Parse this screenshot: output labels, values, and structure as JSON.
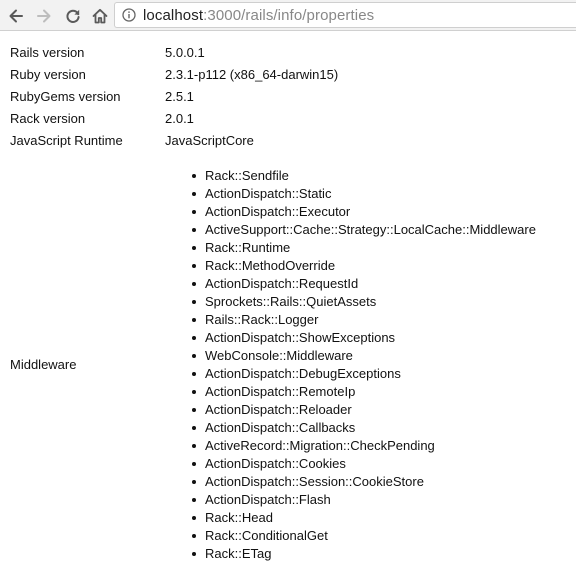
{
  "browser": {
    "url_host": "localhost",
    "url_path": ":3000/rails/info/properties"
  },
  "properties": [
    {
      "key": "Rails version",
      "value": "5.0.0.1"
    },
    {
      "key": "Ruby version",
      "value": "2.3.1-p112 (x86_64-darwin15)"
    },
    {
      "key": "RubyGems version",
      "value": "2.5.1"
    },
    {
      "key": "Rack version",
      "value": "2.0.1"
    },
    {
      "key": "JavaScript Runtime",
      "value": "JavaScriptCore"
    }
  ],
  "middleware": {
    "label": "Middleware",
    "items": [
      "Rack::Sendfile",
      "ActionDispatch::Static",
      "ActionDispatch::Executor",
      "ActiveSupport::Cache::Strategy::LocalCache::Middleware",
      "Rack::Runtime",
      "Rack::MethodOverride",
      "ActionDispatch::RequestId",
      "Sprockets::Rails::QuietAssets",
      "Rails::Rack::Logger",
      "ActionDispatch::ShowExceptions",
      "WebConsole::Middleware",
      "ActionDispatch::DebugExceptions",
      "ActionDispatch::RemoteIp",
      "ActionDispatch::Reloader",
      "ActionDispatch::Callbacks",
      "ActiveRecord::Migration::CheckPending",
      "ActionDispatch::Cookies",
      "ActionDispatch::Session::CookieStore",
      "ActionDispatch::Flash",
      "Rack::Head",
      "Rack::ConditionalGet",
      "Rack::ETag"
    ]
  },
  "icons": {
    "back": "arrow-left-icon",
    "forward": "arrow-right-icon",
    "reload": "reload-icon",
    "home": "home-icon",
    "info": "info-circle-icon"
  },
  "colors": {
    "toolbar_bg": "#f2f2f2",
    "text": "#111111",
    "url_path": "#888888",
    "icon_active": "#5a5a5a",
    "icon_disabled": "#bdbdbd"
  }
}
